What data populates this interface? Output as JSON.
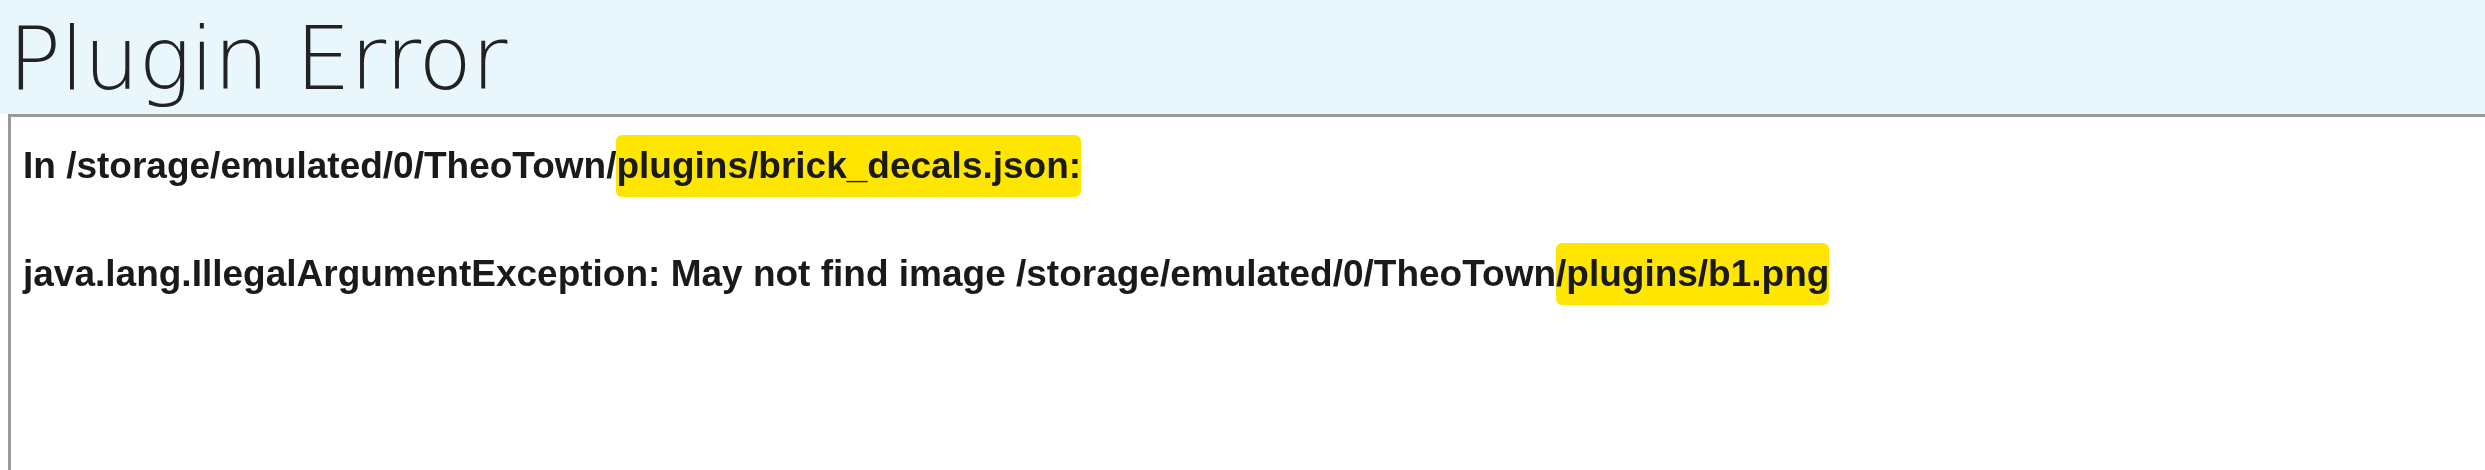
{
  "dialog": {
    "title": "Plugin Error",
    "message_lines": [
      {
        "segments": [
          {
            "text": "In /storage/emulated/0/TheoTown/",
            "highlighted": false
          },
          {
            "text": "plugins/brick_decals.json:",
            "highlighted": true
          }
        ]
      },
      {
        "segments": [
          {
            "text": "java.lang.IllegalArgumentException: May not find image /storage/emulated/0/TheoTown",
            "highlighted": false
          },
          {
            "text": "/plugins/b1.png",
            "highlighted": true
          }
        ]
      }
    ]
  }
}
